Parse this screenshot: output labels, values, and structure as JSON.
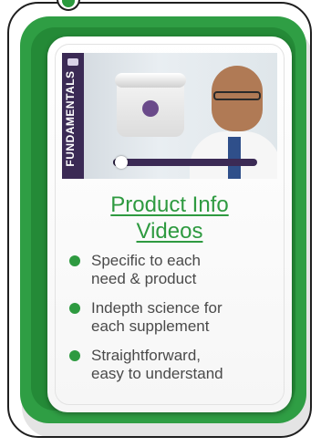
{
  "card": {
    "heading_line1": "Product Info",
    "heading_line2": "Videos",
    "bullets": [
      {
        "line1": "Specific to each",
        "line2": "need & product"
      },
      {
        "line1": "Indepth science for",
        "line2": "each supplement"
      },
      {
        "line1": "Straightforward,",
        "line2": "easy to understand"
      }
    ]
  },
  "video": {
    "side_label": "FUNDAMENTALS",
    "progress": 0.06
  },
  "colors": {
    "green": "#2e9a40",
    "green_dark": "#248a37",
    "video_purple": "#3b2a55"
  }
}
